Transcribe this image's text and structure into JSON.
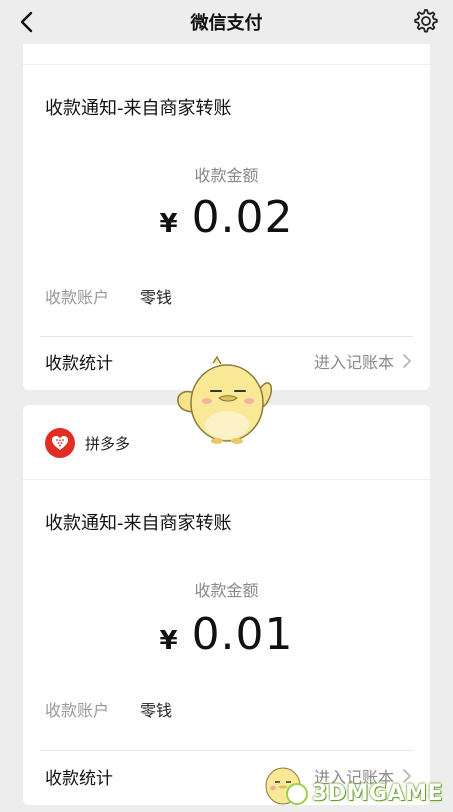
{
  "navbar": {
    "title": "微信支付"
  },
  "cards": [
    {
      "notice_title": "收款通知-来自商家转账",
      "amount_label": "收款金额",
      "currency": "¥",
      "amount": "0.02",
      "account_label": "收款账户",
      "account_value": "零钱",
      "stats_label": "收款统计",
      "stats_link": "进入记账本"
    },
    {
      "merchant_name": "拼多多",
      "notice_title": "收款通知-来自商家转账",
      "amount_label": "收款金额",
      "currency": "¥",
      "amount": "0.01",
      "account_label": "收款账户",
      "account_value": "零钱",
      "stats_label": "收款统计",
      "stats_link": "进入记账本"
    }
  ],
  "watermark": {
    "text": "3DMGAME"
  },
  "colors": {
    "merchant_logo": "#e02e24",
    "background": "#ededed",
    "card": "#ffffff"
  },
  "icons": [
    "back-arrow-icon",
    "settings-gear-icon",
    "chevron-right-icon",
    "pinduoduo-logo-icon",
    "mascot-sticker-icon"
  ]
}
